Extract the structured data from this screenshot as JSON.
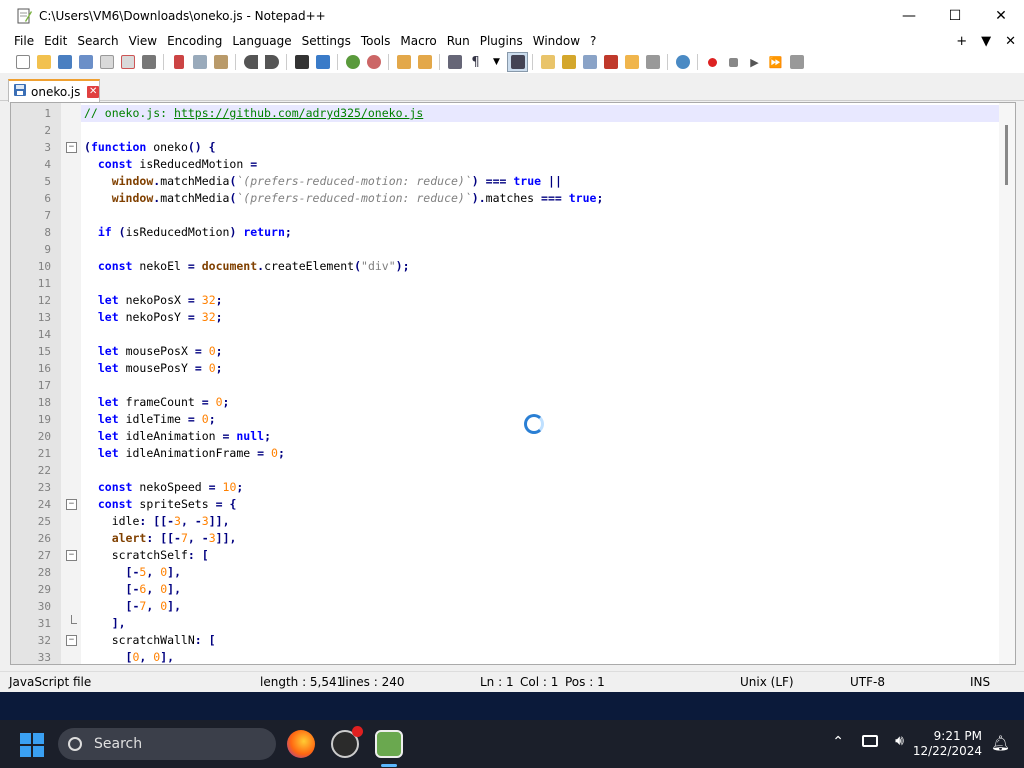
{
  "window": {
    "title": "C:\\Users\\VM6\\Downloads\\oneko.js - Notepad++",
    "minimize": "—",
    "maximize": "☐",
    "close": "✕"
  },
  "menu": {
    "items": [
      "File",
      "Edit",
      "Search",
      "View",
      "Encoding",
      "Language",
      "Settings",
      "Tools",
      "Macro",
      "Run",
      "Plugins",
      "Window",
      "?"
    ],
    "right_plus": "+",
    "right_down": "▼",
    "right_close": "✕"
  },
  "tab": {
    "label": "oneko.js",
    "close": "✕"
  },
  "editor": {
    "lines": [
      {
        "n": "1",
        "html": "<span class=\"cm\">// oneko.js: </span><span class=\"url\">https://github.com/adryd325/oneko.js</span>"
      },
      {
        "n": "2",
        "html": ""
      },
      {
        "n": "3",
        "html": "<span class=\"op\">(</span><span class=\"kw\">function</span> oneko<span class=\"op\">()</span> <span class=\"op\">{</span>"
      },
      {
        "n": "4",
        "html": "  <span class=\"kw\">const</span> isReducedMotion <span class=\"op\">=</span>"
      },
      {
        "n": "5",
        "html": "    <span class=\"obj\">window</span><span class=\"op\">.</span>matchMedia<span class=\"op\">(</span><span class=\"tpl\">`(prefers-reduced-motion: reduce)`</span><span class=\"op\">)</span> <span class=\"op\">===</span> <span class=\"kw\">true</span> <span class=\"op\">||</span>"
      },
      {
        "n": "6",
        "html": "    <span class=\"obj\">window</span><span class=\"op\">.</span>matchMedia<span class=\"op\">(</span><span class=\"tpl\">`(prefers-reduced-motion: reduce)`</span><span class=\"op\">).</span>matches <span class=\"op\">===</span> <span class=\"kw\">true</span><span class=\"op\">;</span>"
      },
      {
        "n": "7",
        "html": ""
      },
      {
        "n": "8",
        "html": "  <span class=\"kw\">if</span> <span class=\"op\">(</span>isReducedMotion<span class=\"op\">)</span> <span class=\"kw\">return</span><span class=\"op\">;</span>"
      },
      {
        "n": "9",
        "html": ""
      },
      {
        "n": "10",
        "html": "  <span class=\"kw\">const</span> nekoEl <span class=\"op\">=</span> <span class=\"obj\">document</span><span class=\"op\">.</span>createElement<span class=\"op\">(</span><span class=\"str\">\"div\"</span><span class=\"op\">);</span>"
      },
      {
        "n": "11",
        "html": ""
      },
      {
        "n": "12",
        "html": "  <span class=\"kw\">let</span> nekoPosX <span class=\"op\">=</span> <span class=\"num\">32</span><span class=\"op\">;</span>"
      },
      {
        "n": "13",
        "html": "  <span class=\"kw\">let</span> nekoPosY <span class=\"op\">=</span> <span class=\"num\">32</span><span class=\"op\">;</span>"
      },
      {
        "n": "14",
        "html": ""
      },
      {
        "n": "15",
        "html": "  <span class=\"kw\">let</span> mousePosX <span class=\"op\">=</span> <span class=\"num\">0</span><span class=\"op\">;</span>"
      },
      {
        "n": "16",
        "html": "  <span class=\"kw\">let</span> mousePosY <span class=\"op\">=</span> <span class=\"num\">0</span><span class=\"op\">;</span>"
      },
      {
        "n": "17",
        "html": ""
      },
      {
        "n": "18",
        "html": "  <span class=\"kw\">let</span> frameCount <span class=\"op\">=</span> <span class=\"num\">0</span><span class=\"op\">;</span>"
      },
      {
        "n": "19",
        "html": "  <span class=\"kw\">let</span> idleTime <span class=\"op\">=</span> <span class=\"num\">0</span><span class=\"op\">;</span>"
      },
      {
        "n": "20",
        "html": "  <span class=\"kw\">let</span> idleAnimation <span class=\"op\">=</span> <span class=\"kw\">null</span><span class=\"op\">;</span>"
      },
      {
        "n": "21",
        "html": "  <span class=\"kw\">let</span> idleAnimationFrame <span class=\"op\">=</span> <span class=\"num\">0</span><span class=\"op\">;</span>"
      },
      {
        "n": "22",
        "html": ""
      },
      {
        "n": "23",
        "html": "  <span class=\"kw\">const</span> nekoSpeed <span class=\"op\">=</span> <span class=\"num\">10</span><span class=\"op\">;</span>"
      },
      {
        "n": "24",
        "html": "  <span class=\"kw\">const</span> spriteSets <span class=\"op\">=</span> <span class=\"op\">{</span>"
      },
      {
        "n": "25",
        "html": "    idle<span class=\"op\">:</span> <span class=\"op\">[[-</span><span class=\"num\">3</span><span class=\"op\">,</span> <span class=\"op\">-</span><span class=\"num\">3</span><span class=\"op\">]],</span>"
      },
      {
        "n": "26",
        "html": "    <span class=\"obj\">alert</span><span class=\"op\">:</span> <span class=\"op\">[[-</span><span class=\"num\">7</span><span class=\"op\">,</span> <span class=\"op\">-</span><span class=\"num\">3</span><span class=\"op\">]],</span>"
      },
      {
        "n": "27",
        "html": "    scratchSelf<span class=\"op\">:</span> <span class=\"op\">[</span>"
      },
      {
        "n": "28",
        "html": "      <span class=\"op\">[-</span><span class=\"num\">5</span><span class=\"op\">,</span> <span class=\"num\">0</span><span class=\"op\">],</span>"
      },
      {
        "n": "29",
        "html": "      <span class=\"op\">[-</span><span class=\"num\">6</span><span class=\"op\">,</span> <span class=\"num\">0</span><span class=\"op\">],</span>"
      },
      {
        "n": "30",
        "html": "      <span class=\"op\">[-</span><span class=\"num\">7</span><span class=\"op\">,</span> <span class=\"num\">0</span><span class=\"op\">],</span>"
      },
      {
        "n": "31",
        "html": "    <span class=\"op\">],</span>"
      },
      {
        "n": "32",
        "html": "    scratchWallN<span class=\"op\">:</span> <span class=\"op\">[</span>"
      },
      {
        "n": "33",
        "html": "      <span class=\"op\">[</span><span class=\"num\">0</span><span class=\"op\">,</span> <span class=\"num\">0</span><span class=\"op\">],</span>"
      }
    ]
  },
  "status": {
    "file_type": "JavaScript file",
    "length": "length : 5,541",
    "lines": "lines : 240",
    "ln": "Ln : 1",
    "col": "Col : 1",
    "pos": "Pos : 1",
    "eol": "Unix (LF)",
    "encoding": "UTF-8",
    "mode": "INS"
  },
  "taskbar": {
    "search_placeholder": "Search",
    "time": "9:21 PM",
    "date": "12/22/2024"
  }
}
